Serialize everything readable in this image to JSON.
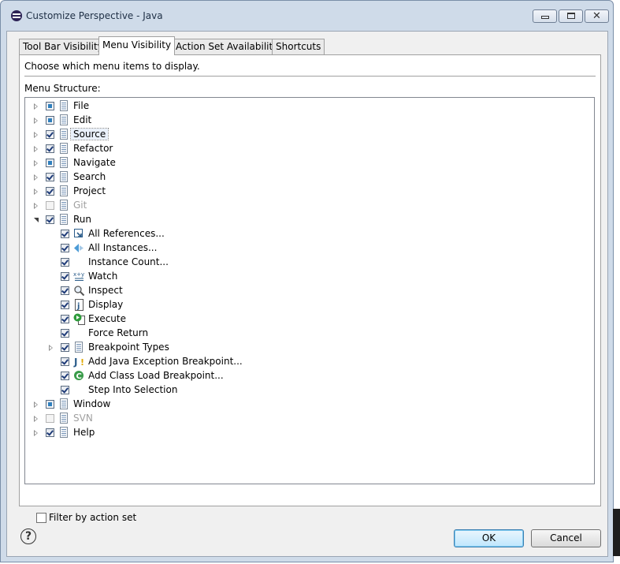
{
  "window": {
    "title": "Customize Perspective - Java",
    "close_glyph": "✕"
  },
  "tabs": [
    {
      "label": "Tool Bar Visibility",
      "active": false
    },
    {
      "label": "Menu Visibility",
      "active": true
    },
    {
      "label": "Action Set Availability",
      "active": false
    },
    {
      "label": "Shortcuts",
      "active": false
    }
  ],
  "panel": {
    "description": "Choose which menu items to display.",
    "structure_label": "Menu Structure:",
    "filter_label": "Filter by action set",
    "filter_checked": false
  },
  "tree": [
    {
      "label": "File",
      "level": 0,
      "expander": "closed",
      "check": "partial",
      "icon": "menu-doc-icon"
    },
    {
      "label": "Edit",
      "level": 0,
      "expander": "closed",
      "check": "partial",
      "icon": "menu-doc-icon"
    },
    {
      "label": "Source",
      "level": 0,
      "expander": "closed",
      "check": "checked",
      "icon": "menu-doc-icon",
      "focused": true
    },
    {
      "label": "Refactor",
      "level": 0,
      "expander": "closed",
      "check": "checked",
      "icon": "menu-doc-icon"
    },
    {
      "label": "Navigate",
      "level": 0,
      "expander": "closed",
      "check": "partial",
      "icon": "menu-doc-icon"
    },
    {
      "label": "Search",
      "level": 0,
      "expander": "closed",
      "check": "checked",
      "icon": "menu-doc-icon"
    },
    {
      "label": "Project",
      "level": 0,
      "expander": "closed",
      "check": "checked",
      "icon": "menu-doc-icon"
    },
    {
      "label": "Git",
      "level": 0,
      "expander": "closed",
      "check": "disabled",
      "icon": "menu-doc-icon",
      "dim": true
    },
    {
      "label": "Run",
      "level": 0,
      "expander": "open",
      "check": "checked",
      "icon": "menu-doc-icon"
    },
    {
      "label": "All References...",
      "level": 1,
      "expander": "none",
      "check": "checked",
      "icon": "all-references-icon"
    },
    {
      "label": "All Instances...",
      "level": 1,
      "expander": "none",
      "check": "checked",
      "icon": "all-instances-icon"
    },
    {
      "label": "Instance Count...",
      "level": 1,
      "expander": "none",
      "check": "checked",
      "icon": "none"
    },
    {
      "label": "Watch",
      "level": 1,
      "expander": "none",
      "check": "checked",
      "icon": "watch-icon"
    },
    {
      "label": "Inspect",
      "level": 1,
      "expander": "none",
      "check": "checked",
      "icon": "inspect-icon"
    },
    {
      "label": "Display",
      "level": 1,
      "expander": "none",
      "check": "checked",
      "icon": "display-icon"
    },
    {
      "label": "Execute",
      "level": 1,
      "expander": "none",
      "check": "checked",
      "icon": "execute-icon"
    },
    {
      "label": "Force Return",
      "level": 1,
      "expander": "none",
      "check": "checked",
      "icon": "none"
    },
    {
      "label": "Breakpoint Types",
      "level": 1,
      "expander": "closed",
      "check": "checked",
      "icon": "menu-doc-icon"
    },
    {
      "label": "Add Java Exception Breakpoint...",
      "level": 1,
      "expander": "none",
      "check": "checked",
      "icon": "exception-breakpoint-icon"
    },
    {
      "label": "Add Class Load Breakpoint...",
      "level": 1,
      "expander": "none",
      "check": "checked",
      "icon": "class-load-breakpoint-icon"
    },
    {
      "label": "Step Into Selection",
      "level": 1,
      "expander": "none",
      "check": "checked",
      "icon": "none"
    },
    {
      "label": "Window",
      "level": 0,
      "expander": "closed",
      "check": "partial",
      "icon": "menu-doc-icon"
    },
    {
      "label": "SVN",
      "level": 0,
      "expander": "closed",
      "check": "disabled",
      "icon": "menu-doc-icon",
      "dim": true
    },
    {
      "label": "Help",
      "level": 0,
      "expander": "closed",
      "check": "checked",
      "icon": "menu-doc-icon"
    }
  ],
  "buttons": {
    "ok": "OK",
    "cancel": "Cancel",
    "help_glyph": "?"
  },
  "colors": {
    "title_bar": "#cfdbe9",
    "partial_check": "#2f7fbd",
    "primary_button_border": "#3c7fb1"
  }
}
